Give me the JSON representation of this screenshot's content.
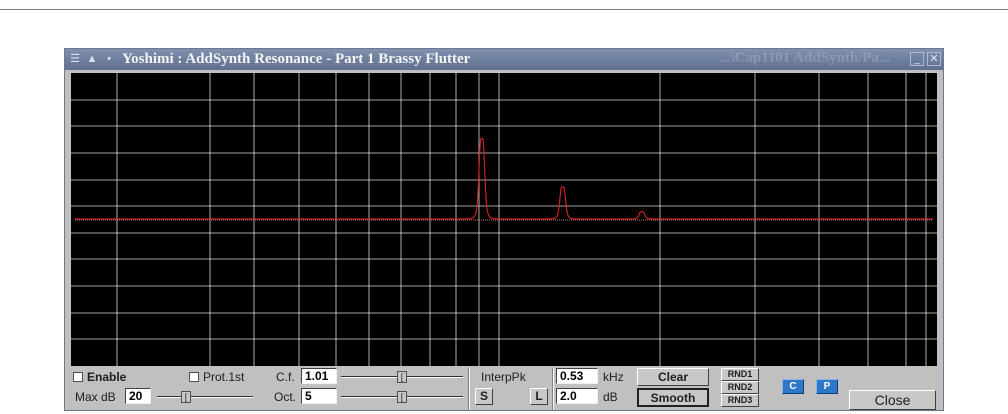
{
  "window": {
    "title": "Yoshimi : AddSynth Resonance - Part 1 Brassy Flutter",
    "ghost_title": "...\\Cap1101 AddSynth/Pa..."
  },
  "graph": {
    "background": "#000000",
    "grid_color": "#ffffff",
    "curve_color": "#cc2222",
    "peaks": [
      {
        "khz": 0.53,
        "height": 0.55
      },
      {
        "khz": 1.01,
        "height": 0.22
      },
      {
        "khz": 1.9,
        "height": 0.05
      }
    ]
  },
  "controls": {
    "enable_label": "Enable",
    "prot1st_label": "Prot.1st",
    "maxdb_label": "Max dB",
    "maxdb_value": "20",
    "cf_label": "C.f.",
    "cf_value": "1.01",
    "oct_label": "Oct.",
    "oct_value": "5",
    "interp_label": "InterpPk",
    "s_label": "S",
    "l_label": "L",
    "khz_value": "0.53",
    "khz_unit": "kHz",
    "db_value": "2.0",
    "db_unit": "dB",
    "clear_label": "Clear",
    "smooth_label": "Smooth",
    "rnd1_label": "RND1",
    "rnd2_label": "RND2",
    "rnd3_label": "RND3",
    "c_label": "C",
    "p_label": "P",
    "close_label": "Close",
    "accent_blue": "#2f77c8"
  }
}
